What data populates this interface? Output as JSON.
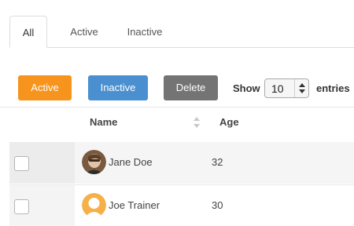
{
  "tabs": [
    {
      "label": "All",
      "active": true
    },
    {
      "label": "Active",
      "active": false
    },
    {
      "label": "Inactive",
      "active": false
    }
  ],
  "toolbar": {
    "active_label": "Active",
    "inactive_label": "Inactive",
    "delete_label": "Delete",
    "show_label": "Show",
    "page_size": "10",
    "entries_label": "entries"
  },
  "colors": {
    "active_button": "#f7941d",
    "inactive_button": "#4a8fd0",
    "delete_button": "#747474"
  },
  "table": {
    "columns": [
      "Name",
      "Age"
    ],
    "rows": [
      {
        "name": "Jane Doe",
        "age": "32",
        "avatar": "photo-avatar-icon"
      },
      {
        "name": "Joe Trainer",
        "age": "30",
        "avatar": "default-user-avatar-icon"
      }
    ]
  }
}
